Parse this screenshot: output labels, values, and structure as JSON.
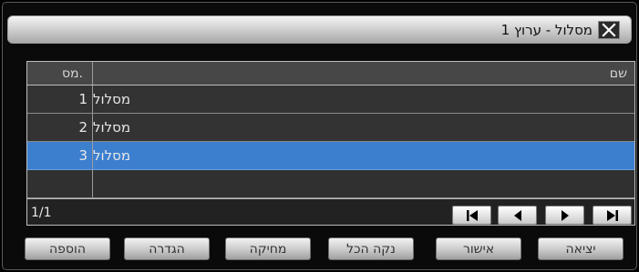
{
  "dialog": {
    "title": "מסלול - ערוץ 1"
  },
  "table": {
    "headers": {
      "no": "מס.",
      "name": "שם"
    },
    "rows": [
      {
        "no": "1",
        "name": "מסלול",
        "selected": false
      },
      {
        "no": "2",
        "name": "מסלול",
        "selected": false
      },
      {
        "no": "3",
        "name": "מסלול",
        "selected": true
      }
    ],
    "page": "1/1"
  },
  "icons": {
    "close": "close-icon",
    "first": "first-page-icon",
    "prev": "previous-page-icon",
    "next": "next-page-icon",
    "last": "last-page-icon"
  },
  "colors": {
    "selected_row": "#3d7fcf",
    "title_gradient_top": "#f4f4f4",
    "title_gradient_bottom": "#a9a9a9"
  },
  "buttons": {
    "exit": "יציאה",
    "confirm": "אישור",
    "clear_all": "נקה הכל",
    "delete": "מחיקה",
    "setup": "הגדרה",
    "add": "הוספה"
  }
}
